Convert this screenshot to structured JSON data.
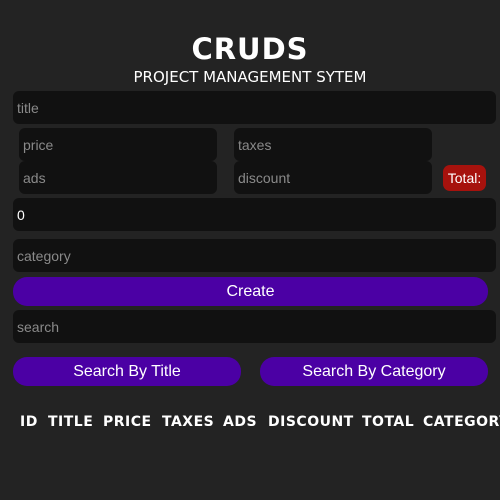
{
  "header": {
    "title": "CRUDS",
    "subtitle": "PROJECT MANAGEMENT SYTEM"
  },
  "form": {
    "title": {
      "placeholder": "title",
      "value": ""
    },
    "price": {
      "placeholder": "price",
      "value": ""
    },
    "taxes": {
      "placeholder": "taxes",
      "value": ""
    },
    "ads": {
      "placeholder": "ads",
      "value": ""
    },
    "discount": {
      "placeholder": "discount",
      "value": ""
    },
    "total_label": "Total:",
    "count": {
      "placeholder": "",
      "value": "0"
    },
    "category": {
      "placeholder": "category",
      "value": ""
    },
    "create_label": "Create"
  },
  "search": {
    "input": {
      "placeholder": "search",
      "value": ""
    },
    "by_title_label": "Search By Title",
    "by_category_label": "Search By Category"
  },
  "table": {
    "headers": [
      "ID",
      "TITLE",
      "PRICE",
      "TAXES",
      "ADS",
      "DISCOUNT",
      "TOTAL",
      "CATEGORY"
    ]
  },
  "colors": {
    "background": "#232323",
    "input_background": "#111111",
    "accent": "#4b00a4",
    "total_badge": "#a6120d"
  }
}
